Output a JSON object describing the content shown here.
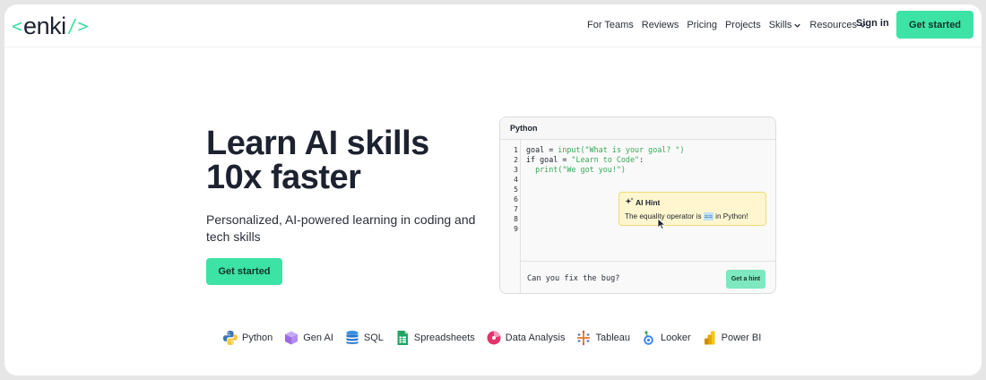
{
  "logo": {
    "left_bracket": "<",
    "word": "enki",
    "right_bracket": "/>"
  },
  "nav": {
    "links": [
      "For Teams",
      "Reviews",
      "Pricing",
      "Projects",
      "Skills",
      "Resources"
    ],
    "sign_in": "Sign in",
    "cta": "Get started"
  },
  "hero": {
    "title_line1": "Learn AI skills",
    "title_line2": "10x faster",
    "subtitle": "Personalized, AI-powered learning in coding and tech skills",
    "cta": "Get started"
  },
  "editor": {
    "tab": "Python",
    "line_numbers": [
      "1",
      "2",
      "3",
      "4",
      "5",
      "6",
      "7",
      "8",
      "9"
    ],
    "code": {
      "l1_a": "goal = ",
      "l1_fn": "input",
      "l1_str": "(\"What is your goal? \")",
      "l2_a": "if goal = ",
      "l2_str": "\"Learn to Code\"",
      "l2_b": ":",
      "l3_a": "  ",
      "l3_fn": "print",
      "l3_str": "(\"We got you!\")"
    },
    "hint": {
      "title": "AI Hint",
      "text_before": "The equality operator is ",
      "operator": "==",
      "text_after": " in Python!"
    },
    "prompt": "Can you fix the bug?",
    "hint_button": "Get a hint"
  },
  "skills": [
    {
      "label": "Python",
      "icon": "python-icon"
    },
    {
      "label": "Gen AI",
      "icon": "gen-ai-cube-icon"
    },
    {
      "label": "SQL",
      "icon": "database-icon"
    },
    {
      "label": "Spreadsheets",
      "icon": "spreadsheet-icon"
    },
    {
      "label": "Data Analysis",
      "icon": "pie-chart-icon"
    },
    {
      "label": "Tableau",
      "icon": "tableau-icon"
    },
    {
      "label": "Looker",
      "icon": "looker-icon"
    },
    {
      "label": "Power BI",
      "icon": "power-bi-icon"
    }
  ],
  "colors": {
    "accent": "#3de2a5",
    "text": "#1d2230",
    "hint_bg": "#fff6cf"
  }
}
